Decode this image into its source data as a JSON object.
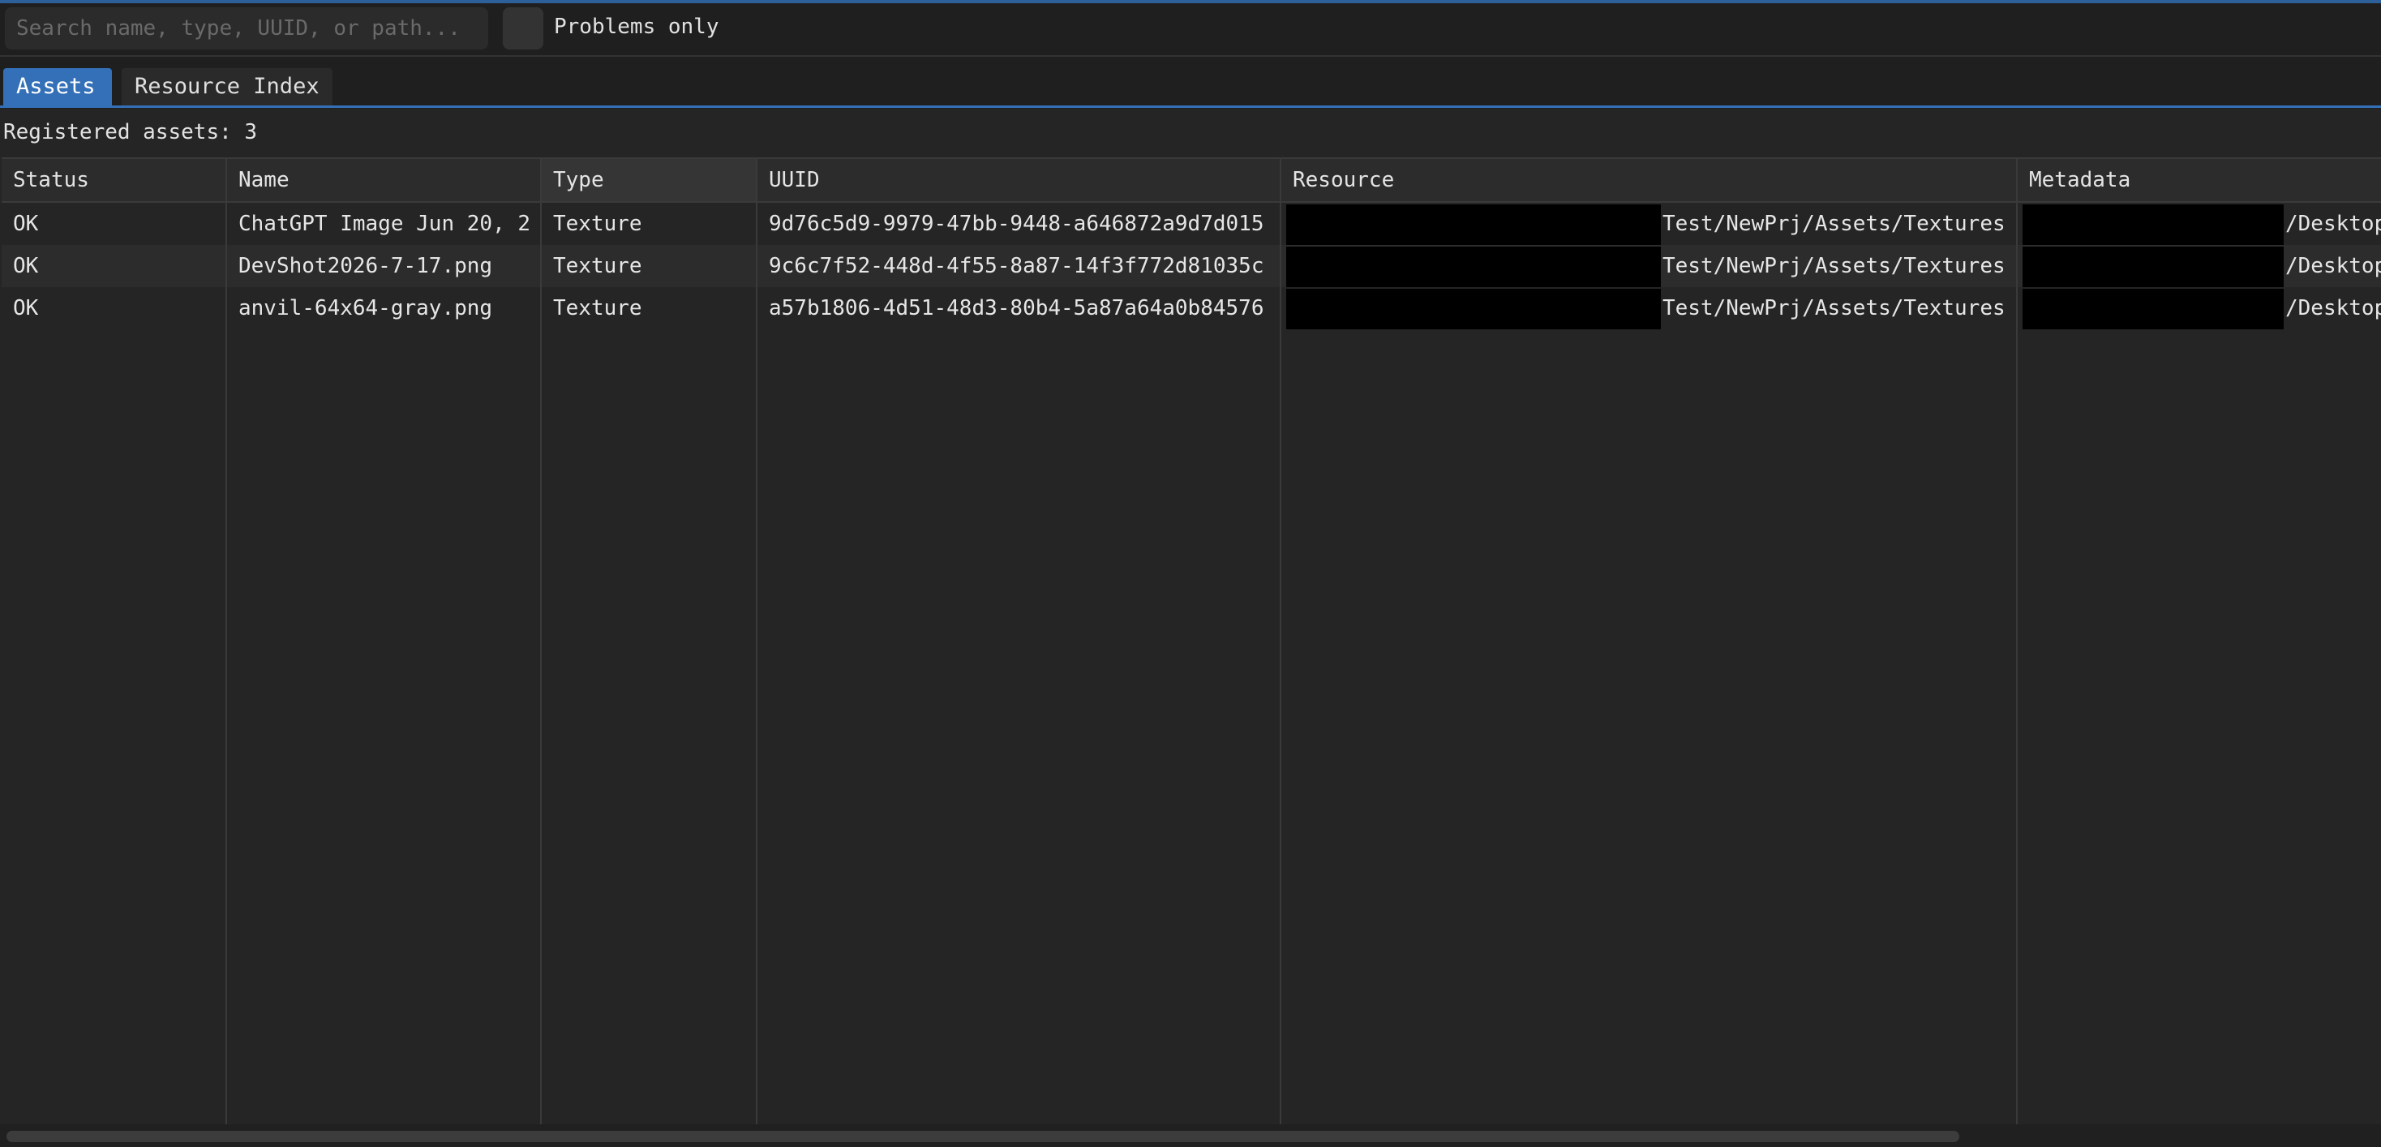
{
  "toolbar": {
    "search_placeholder": "Search name, type, UUID, or path...",
    "search_value": "",
    "problems_only_label": "Problems only",
    "problems_only_checked": false
  },
  "tabs": [
    {
      "label": "Assets",
      "active": true
    },
    {
      "label": "Resource Index",
      "active": false
    }
  ],
  "summary": "Registered assets: 3",
  "table": {
    "columns": [
      "Status",
      "Name",
      "Type",
      "UUID",
      "Resource",
      "Metadata"
    ],
    "rows": [
      {
        "status": "OK",
        "name": "ChatGPT Image Jun 20, 2",
        "type": "Texture",
        "uuid": "9d76c5d9-9979-47bb-9448-a646872a9d7d015",
        "resource": "Test/NewPrj/Assets/Textures",
        "metadata": "/Desktop"
      },
      {
        "status": "OK",
        "name": "DevShot2026-7-17.png",
        "type": "Texture",
        "uuid": "9c6c7f52-448d-4f55-8a87-14f3f772d81035c",
        "resource": "Test/NewPrj/Assets/Textures",
        "metadata": "/Desktop"
      },
      {
        "status": "OK",
        "name": "anvil-64x64-gray.png",
        "type": "Texture",
        "uuid": "a57b1806-4d51-48d3-80b4-5a87a64a0b84576",
        "resource": "Test/NewPrj/Assets/Textures",
        "metadata": "/Desktop"
      }
    ]
  },
  "colors": {
    "accent": "#3470b8",
    "background": "#252525",
    "header": "#2c2c2c",
    "redaction": "#000000"
  }
}
